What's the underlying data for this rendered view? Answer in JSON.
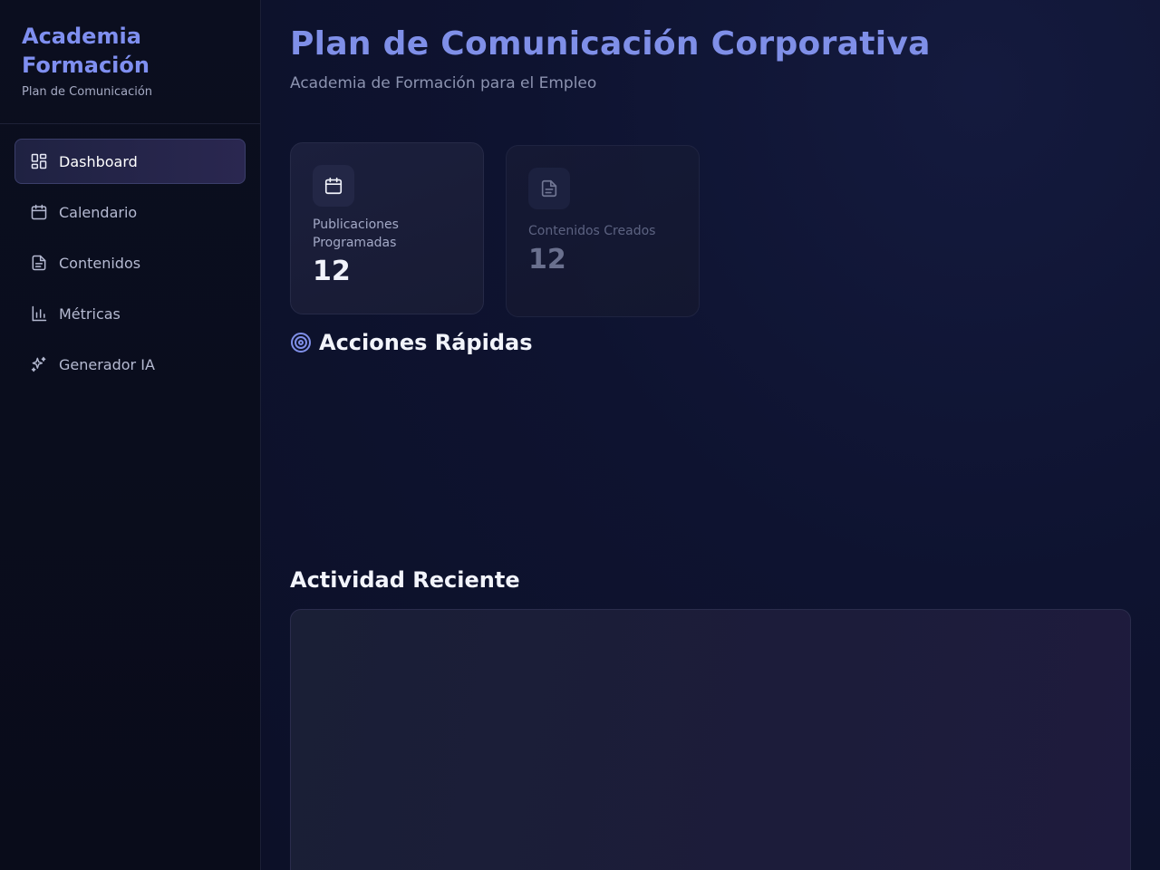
{
  "brand": {
    "title": "Academia Formación",
    "subtitle": "Plan de Comunicación"
  },
  "sidebar": {
    "items": [
      {
        "label": "Dashboard",
        "icon": "dashboard-icon",
        "active": true
      },
      {
        "label": "Calendario",
        "icon": "calendar-icon",
        "active": false
      },
      {
        "label": "Contenidos",
        "icon": "document-icon",
        "active": false
      },
      {
        "label": "Métricas",
        "icon": "bar-chart-icon",
        "active": false
      },
      {
        "label": "Generador IA",
        "icon": "sparkles-icon",
        "active": false
      }
    ]
  },
  "header": {
    "title": "Plan de Comunicación Corporativa",
    "subtitle": "Academia de Formación para el Empleo"
  },
  "stats": [
    {
      "label": "Publicaciones Programadas",
      "value": "12",
      "icon": "calendar-icon"
    },
    {
      "label": "Contenidos Creados",
      "value": "12",
      "icon": "document-icon"
    }
  ],
  "sections": {
    "quick_actions": "Acciones Rápidas",
    "recent_activity": "Actividad Reciente"
  },
  "colors": {
    "accent": "#7f8fe8",
    "background": "#0c1026"
  }
}
